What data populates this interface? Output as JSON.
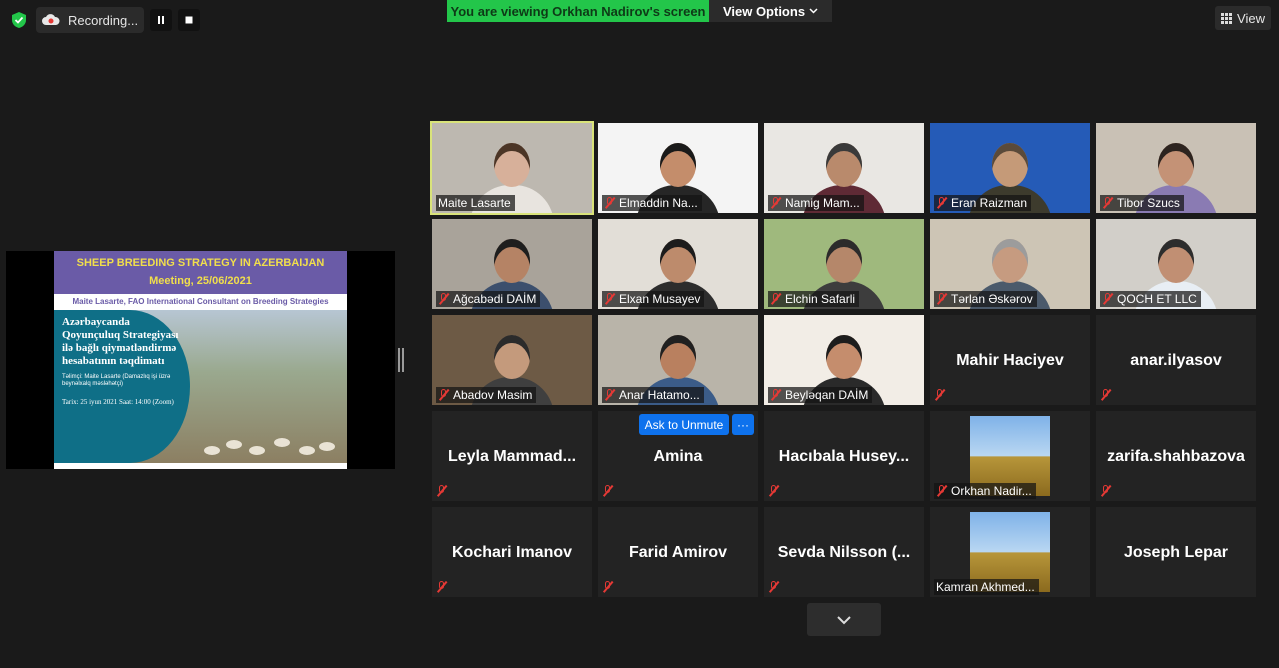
{
  "toolbar": {
    "recording_label": "Recording...",
    "banner_text": "You are viewing Orkhan Nadirov's screen",
    "view_options_label": "View Options",
    "view_label": "View"
  },
  "shared_slide": {
    "title": "SHEEP BREEDING STRATEGY IN AZERBAIJAN",
    "meeting": "Meeting, 25/06/2021",
    "presenter": "Maite Lasarte, FAO International Consultant on Breeding Strategies",
    "az_title": "Azərbaycanda Qoyunçuluq Strategiyası ilə bağlı qiymətləndirmə hesabatının təqdimatı",
    "az_presenter": "Təlimçi: Maite Lasarte (Damazlıq işi üzrə beynəlxalq məsləhətçi)",
    "date_line": "Tarix: 25 iyun 2021 Saat: 14:00 (Zoom)"
  },
  "participants": [
    {
      "name": "Maite Lasarte",
      "video": true,
      "muted": false,
      "active": true,
      "bg": "#bdb8b0",
      "skin": "#d7b09a",
      "shirt": "#e8e4df",
      "hair": "#4b3526"
    },
    {
      "name": "Elmaddin Na...",
      "video": true,
      "muted": true,
      "bg": "#f4f4f4",
      "skin": "#c48d6b",
      "shirt": "#262626",
      "hair": "#1a1a1a"
    },
    {
      "name": "Namig Mam...",
      "video": true,
      "muted": true,
      "bg": "#e9e7e3",
      "skin": "#b98a6c",
      "shirt": "#5f2a35",
      "hair": "#3a3a3a"
    },
    {
      "name": "Eran Raizman",
      "video": true,
      "muted": true,
      "bg": "#255bb7",
      "skin": "#c59a78",
      "shirt": "#3d3b2d",
      "hair": "#5a4a3a"
    },
    {
      "name": "Tibor Szucs",
      "video": true,
      "muted": true,
      "bg": "#c9c1b5",
      "skin": "#c49276",
      "shirt": "#8a7bb3",
      "hair": "#2d241f"
    },
    {
      "name": "Ağcabədi DAİM",
      "video": true,
      "muted": true,
      "bg": "#a9a39a",
      "skin": "#b58365",
      "shirt": "#3c4f6d",
      "hair": "#1e1e1e"
    },
    {
      "name": "Elxan Musayev",
      "video": true,
      "muted": true,
      "bg": "#e2ded7",
      "skin": "#bd8b6c",
      "shirt": "#2d2d2d",
      "hair": "#1c1c1c"
    },
    {
      "name": "Elchin Safarli",
      "video": true,
      "muted": true,
      "bg": "#9fb97d",
      "skin": "#b5876a",
      "shirt": "#3d3d3d",
      "hair": "#2b2b2b"
    },
    {
      "name": "Tərlan Əskərov",
      "video": true,
      "muted": true,
      "bg": "#cdc5b5",
      "skin": "#c69b80",
      "shirt": "#4b5a6b",
      "hair": "#9c9c9c"
    },
    {
      "name": "QOCH ET LLC",
      "video": true,
      "muted": true,
      "bg": "#d2cfc9",
      "skin": "#c18f73",
      "shirt": "#e8eef4",
      "hair": "#2d2d2d"
    },
    {
      "name": "Abadov Masim",
      "video": true,
      "muted": true,
      "bg": "#6d5a45",
      "skin": "#c49a7c",
      "shirt": "#3f3f3f",
      "hair": "#2b2b2b"
    },
    {
      "name": "Anar Hatamo...",
      "video": true,
      "muted": true,
      "bg": "#b9b4a9",
      "skin": "#b9805f",
      "shirt": "#3b5c89",
      "hair": "#202020"
    },
    {
      "name": "Beyləqan DAİM",
      "video": true,
      "muted": true,
      "bg": "#f2ede6",
      "skin": "#c58d6d",
      "shirt": "#2a2a2a",
      "hair": "#1d1d1d"
    },
    {
      "name": "Mahir Haciyev",
      "video": false,
      "muted": true
    },
    {
      "name": "anar.ilyasov",
      "video": false,
      "muted": true
    },
    {
      "name": "Leyla  Mammad...",
      "video": false,
      "muted": true
    },
    {
      "name": "Amina",
      "video": false,
      "muted": true
    },
    {
      "name": "Hacıbala  Husey...",
      "video": false,
      "muted": true
    },
    {
      "name": "Orkhan Nadir...",
      "video": false,
      "avatar": true,
      "muted": true
    },
    {
      "name": "zarifa.shahbazova",
      "video": false,
      "muted": true
    },
    {
      "name": "Kochari Imanov",
      "video": false,
      "muted": true
    },
    {
      "name": "Farid Amirov",
      "video": false,
      "muted": true
    },
    {
      "name": "Sevda  Nilsson  (...",
      "video": false,
      "muted": true
    },
    {
      "name": "Kamran Akhmed...",
      "video": false,
      "avatar": true,
      "muted": false
    },
    {
      "name": "Joseph Lepar",
      "video": false,
      "muted": false
    }
  ],
  "ask_to_unmute_label": "Ask to Unmute",
  "more_label": "···"
}
